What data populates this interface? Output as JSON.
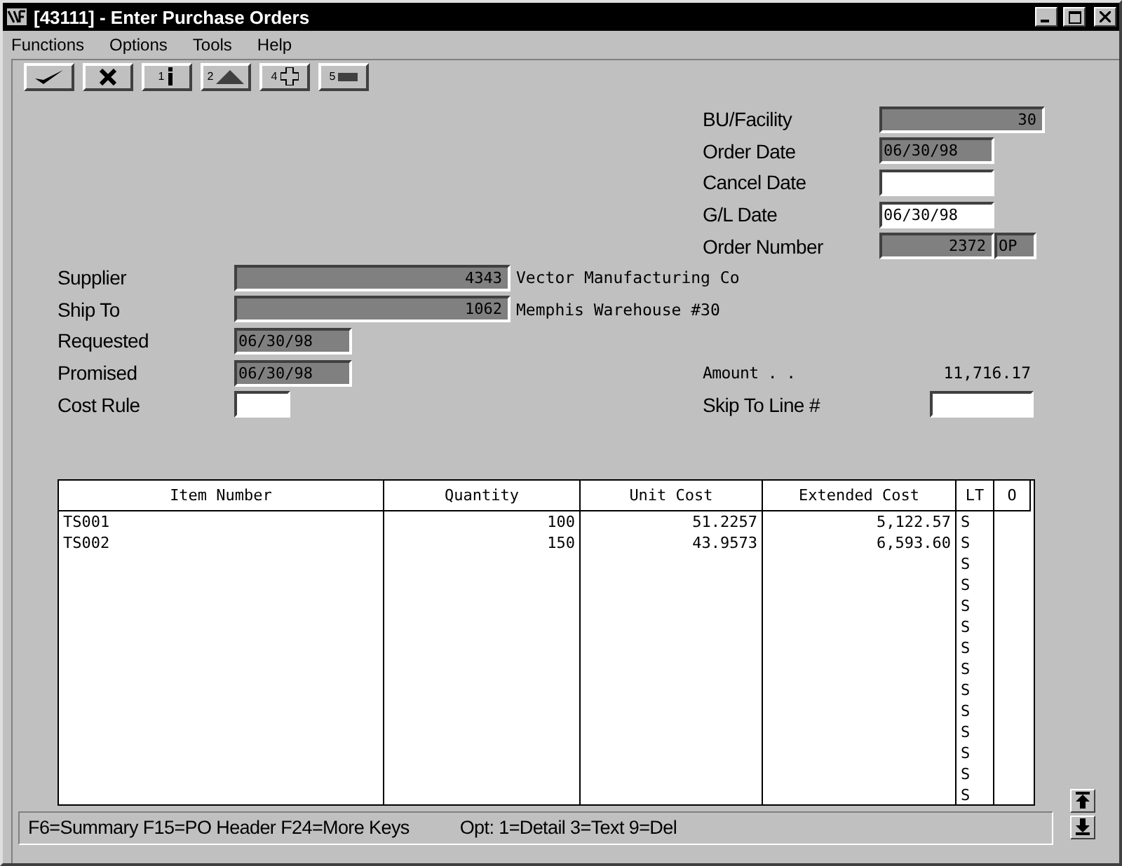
{
  "window": {
    "title": "[43111] - Enter Purchase Orders"
  },
  "menu": [
    "Functions",
    "Options",
    "Tools",
    "Help"
  ],
  "toolbar": [
    {
      "kind": "check"
    },
    {
      "kind": "cancel"
    },
    {
      "kind": "info",
      "key": "1"
    },
    {
      "kind": "up",
      "key": "2"
    },
    {
      "kind": "plus",
      "key": "4"
    },
    {
      "kind": "minus",
      "key": "5"
    }
  ],
  "header_fields": [
    {
      "label": "BU/Facility",
      "value": "30",
      "kind": "wide",
      "disabled": true
    },
    {
      "label": "Order Date",
      "value": "06/30/98",
      "kind": "date",
      "disabled": true
    },
    {
      "label": "Cancel Date",
      "kind": "date",
      "disabled": false
    },
    {
      "label": "G/L Date",
      "value": "06/30/98",
      "kind": "date",
      "disabled": false
    },
    {
      "label": "Order Number",
      "value": "2372",
      "suffix": "OP",
      "kind": "order",
      "disabled": true
    }
  ],
  "party_fields": [
    {
      "label": "Supplier",
      "value": "4343",
      "description": "Vector Manufacturing Co"
    },
    {
      "label": "Ship To",
      "value": "1062",
      "description": "Memphis Warehouse #30"
    }
  ],
  "date_fields": [
    {
      "label": "Requested",
      "value": "06/30/98"
    },
    {
      "label": "Promised",
      "value": "06/30/98"
    }
  ],
  "cost_rule": {
    "label": "Cost Rule"
  },
  "amount": {
    "label": "Amount . .",
    "value": "11,716.17"
  },
  "skip_to_line": {
    "label": "Skip To Line #"
  },
  "table": {
    "columns": [
      "Item Number",
      "Quantity",
      "Unit Cost",
      "Extended Cost",
      "LT",
      "O"
    ],
    "rows": [
      [
        "TS001",
        "100",
        "51.2257",
        "5,122.57",
        "S",
        ""
      ],
      [
        "TS002",
        "150",
        "43.9573",
        "6,593.60",
        "S",
        ""
      ],
      [
        "",
        "",
        "",
        "",
        "S",
        ""
      ],
      [
        "",
        "",
        "",
        "",
        "S",
        ""
      ],
      [
        "",
        "",
        "",
        "",
        "S",
        ""
      ],
      [
        "",
        "",
        "",
        "",
        "S",
        ""
      ],
      [
        "",
        "",
        "",
        "",
        "S",
        ""
      ],
      [
        "",
        "",
        "",
        "",
        "S",
        ""
      ],
      [
        "",
        "",
        "",
        "",
        "S",
        ""
      ],
      [
        "",
        "",
        "",
        "",
        "S",
        ""
      ],
      [
        "",
        "",
        "",
        "",
        "S",
        ""
      ],
      [
        "",
        "",
        "",
        "",
        "S",
        ""
      ],
      [
        "",
        "",
        "",
        "",
        "S",
        ""
      ],
      [
        "",
        "",
        "",
        "",
        "S",
        ""
      ]
    ]
  },
  "status_bar": {
    "keys": "F6=Summary  F15=PO Header  F24=More Keys",
    "options": "Opt: 1=Detail  3=Text  9=Del"
  }
}
